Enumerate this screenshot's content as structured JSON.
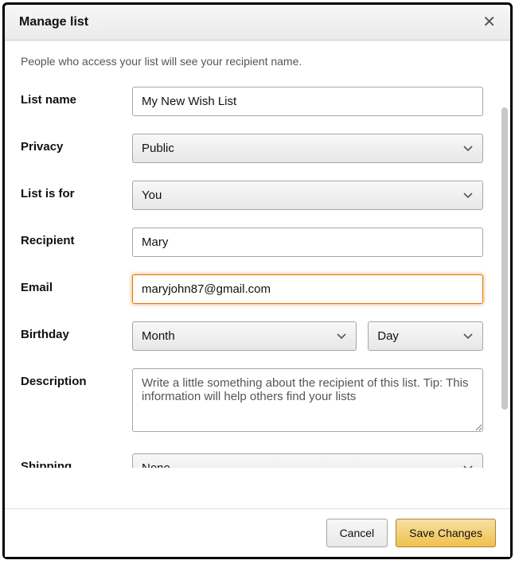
{
  "header": {
    "title": "Manage list"
  },
  "hint": "People who access your list will see your recipient name.",
  "labels": {
    "list_name": "List name",
    "privacy": "Privacy",
    "list_is_for": "List is for",
    "recipient": "Recipient",
    "email": "Email",
    "birthday": "Birthday",
    "description": "Description",
    "shipping": "Shipping"
  },
  "fields": {
    "list_name": "My New Wish List",
    "privacy": "Public",
    "list_is_for": "You",
    "recipient": "Mary",
    "email": "maryjohn87@gmail.com",
    "birthday_month": "Month",
    "birthday_day": "Day",
    "description_placeholder": "Write a little something about the recipient of this list. Tip: This information will help others find your lists",
    "shipping": "None"
  },
  "footer": {
    "cancel": "Cancel",
    "save": "Save Changes"
  }
}
